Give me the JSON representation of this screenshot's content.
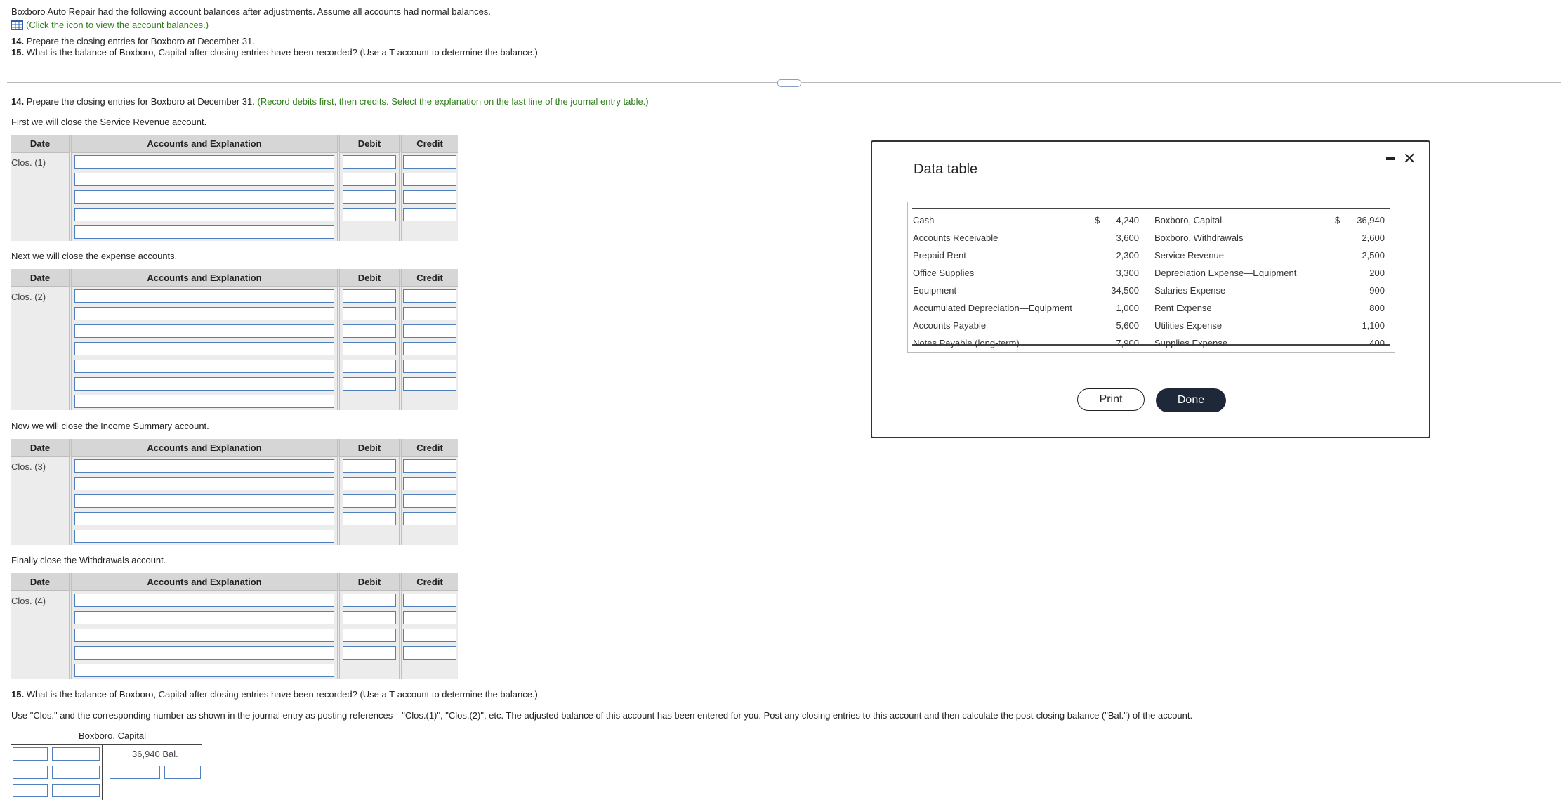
{
  "intro": {
    "line1": "Boxboro Auto Repair had the following account balances after adjustments. Assume all accounts had normal balances.",
    "link": "(Click the icon to view the account balances.)",
    "q14_num": "14.",
    "q14_text": " Prepare the closing entries for Boxboro at December 31.",
    "q15_num": "15.",
    "q15_text": " What is the balance of Boxboro, Capital after closing entries have been recorded? (Use a T-account to determine the balance.)"
  },
  "drag_handle": "....",
  "part14": {
    "num": "14.",
    "text": " Prepare the closing entries for Boxboro at December 31.",
    "instruction": " (Record debits first, then credits. Select the explanation on the last line of the journal entry table.)"
  },
  "headers": {
    "date": "Date",
    "accounts": "Accounts and Explanation",
    "debit": "Debit",
    "credit": "Credit"
  },
  "sections": [
    {
      "label": "First we will close the Service Revenue account.",
      "date": "Clos. (1)"
    },
    {
      "label": "Next we will close the expense accounts.",
      "date": "Clos. (2)"
    },
    {
      "label": "Now we will close the Income Summary account.",
      "date": "Clos. (3)"
    },
    {
      "label": "Finally close the Withdrawals account.",
      "date": "Clos. (4)"
    }
  ],
  "part15": {
    "num": "15.",
    "text": " What is the balance of Boxboro, Capital after closing entries have been recorded? (Use a T-account to determine the balance.)",
    "instruction": "Use \"Clos.\" and the corresponding number as shown in the journal entry as posting references—\"Clos.(1)\", \"Clos.(2)\", etc. The adjusted balance of this account has been entered for you. Post any closing entries to this account and then calculate the post-closing balance (\"Bal.\") of the account."
  },
  "taccount": {
    "title": "Boxboro, Capital",
    "balance": "36,940 Bal."
  },
  "modal": {
    "title": "Data table",
    "rows": [
      {
        "a": "Cash",
        "cur1": "$",
        "v1": "4,240",
        "b": "Boxboro, Capital",
        "cur2": "$",
        "v2": "36,940"
      },
      {
        "a": "Accounts Receivable",
        "cur1": "",
        "v1": "3,600",
        "b": "Boxboro, Withdrawals",
        "cur2": "",
        "v2": "2,600"
      },
      {
        "a": "Prepaid Rent",
        "cur1": "",
        "v1": "2,300",
        "b": "Service Revenue",
        "cur2": "",
        "v2": "2,500"
      },
      {
        "a": "Office Supplies",
        "cur1": "",
        "v1": "3,300",
        "b": "Depreciation Expense—Equipment",
        "cur2": "",
        "v2": "200"
      },
      {
        "a": "Equipment",
        "cur1": "",
        "v1": "34,500",
        "b": "Salaries Expense",
        "cur2": "",
        "v2": "900"
      },
      {
        "a": "Accumulated Depreciation—Equipment",
        "cur1": "",
        "v1": "1,000",
        "b": "Rent Expense",
        "cur2": "",
        "v2": "800"
      },
      {
        "a": "Accounts Payable",
        "cur1": "",
        "v1": "5,600",
        "b": "Utilities Expense",
        "cur2": "",
        "v2": "1,100"
      },
      {
        "a": "Notes Payable (long-term)",
        "cur1": "",
        "v1": "7,900",
        "b": "Supplies Expense",
        "cur2": "",
        "v2": "400"
      }
    ],
    "print": "Print",
    "done": "Done"
  }
}
